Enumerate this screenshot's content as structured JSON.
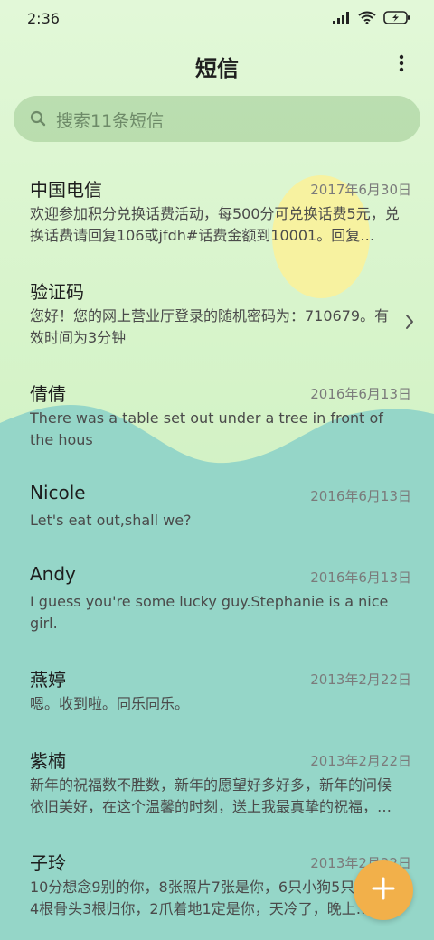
{
  "theme": {
    "sky_top": "#dcf6d2",
    "sky_bottom": "#c5edb6",
    "sea": "#95d6c8",
    "sun": "#f7f2a0",
    "fab": "#f2b04a"
  },
  "status_bar": {
    "time": "2:36",
    "icons": [
      "signal-icon",
      "wifi-icon",
      "battery-charging-icon"
    ]
  },
  "header": {
    "title": "短信",
    "menu_icon": "more-vertical-icon"
  },
  "search": {
    "placeholder": "搜索11条短信",
    "icon": "search-icon"
  },
  "conversations": [
    {
      "name": "中国电信",
      "date": "2017年6月30日",
      "preview": "欢迎参加积分兑换话费活动，每500分可兑换话费5元，兑换话费请回复106或jfdh#话费金额到10001。回复…"
    },
    {
      "name": "验证码",
      "date": "",
      "preview": "您好！您的网上营业厅登录的随机密码为：710679。有效时间为3分钟",
      "chevron": true
    },
    {
      "name": "倩倩",
      "date": "2016年6月13日",
      "preview": "There was a table set out under a tree in front of the hous"
    },
    {
      "name": "Nicole",
      "date": "2016年6月13日",
      "preview": "Let's eat out,shall we?"
    },
    {
      "name": "Andy",
      "date": "2016年6月13日",
      "preview": "I guess you're some lucky guy.Stephanie is a nice girl."
    },
    {
      "name": "燕婷",
      "date": "2013年2月22日",
      "preview": "嗯。收到啦。同乐同乐。"
    },
    {
      "name": "紫楠",
      "date": "2013年2月22日",
      "preview": "新年的祝福数不胜数，新年的愿望好多好多，新年的问候依旧美好，在这个温馨的时刻，送上我最真挚的祝福，…"
    },
    {
      "name": "子玲",
      "date": "2013年2月22日",
      "preview": "10分想念9别的你，8张照片7张是你，6只小狗5只是你，4根骨头3根归你，2爪着地1定是你，天冷了，晚上…"
    }
  ],
  "fab": {
    "icon": "plus-icon"
  }
}
